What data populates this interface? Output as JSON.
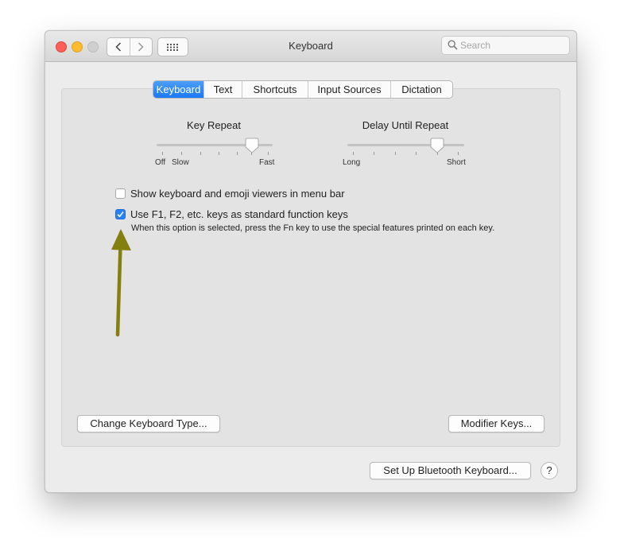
{
  "window": {
    "title": "Keyboard"
  },
  "search": {
    "placeholder": "Search"
  },
  "tabs": [
    {
      "label": "Keyboard",
      "active": true
    },
    {
      "label": "Text",
      "active": false
    },
    {
      "label": "Shortcuts",
      "active": false
    },
    {
      "label": "Input Sources",
      "active": false
    },
    {
      "label": "Dictation",
      "active": false
    }
  ],
  "key_repeat": {
    "title": "Key Repeat",
    "label_off": "Off",
    "label_slow": "Slow",
    "label_fast": "Fast",
    "level": 0.83
  },
  "delay_until_repeat": {
    "title": "Delay Until Repeat",
    "label_long": "Long",
    "label_short": "Short",
    "level": 0.8
  },
  "options": {
    "emoji_viewer": {
      "label": "Show keyboard and emoji viewers in menu bar",
      "checked": false
    },
    "function_keys": {
      "label": "Use F1, F2, etc. keys as standard function keys",
      "checked": true,
      "note": "When this option is selected, press the Fn key to use the special features printed on each key."
    }
  },
  "buttons": {
    "change_keyboard_type": "Change Keyboard Type...",
    "modifier_keys": "Modifier Keys...",
    "bluetooth_setup": "Set Up Bluetooth Keyboard...",
    "help": "?"
  },
  "colors": {
    "accent": "#1c78f6",
    "annotation_arrow": "#857f0f"
  }
}
